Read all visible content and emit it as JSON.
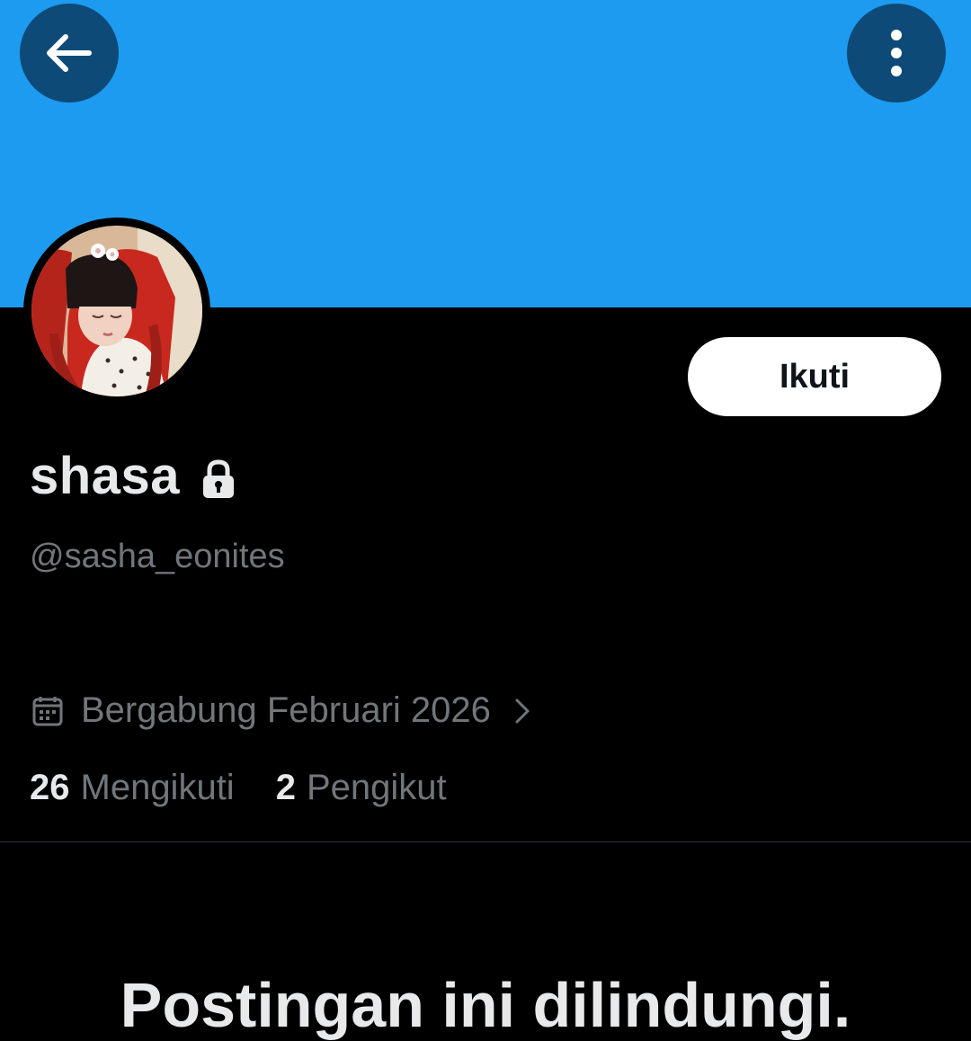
{
  "header": {
    "back_icon": "arrow-left-icon",
    "more_icon": "more-vertical-icon",
    "banner_color": "#1d9bf0",
    "button_bg_color": "#0d4a78"
  },
  "profile": {
    "display_name": "shasa",
    "protected_icon": "lock-icon",
    "handle": "@sasha_eonites",
    "follow_label": "Ikuti",
    "joined_icon": "calendar-icon",
    "joined_text": "Bergabung Februari 2026",
    "joined_chevron_icon": "chevron-right-icon"
  },
  "stats": {
    "following_count": "26",
    "following_label": "Mengikuti",
    "followers_count": "2",
    "followers_label": "Pengikut"
  },
  "protected_notice": {
    "title": "Postingan ini dilindungi."
  },
  "colors": {
    "background": "#000000",
    "primary_text": "#e7e9ea",
    "secondary_text": "#71767b",
    "divider": "#2f3336"
  }
}
